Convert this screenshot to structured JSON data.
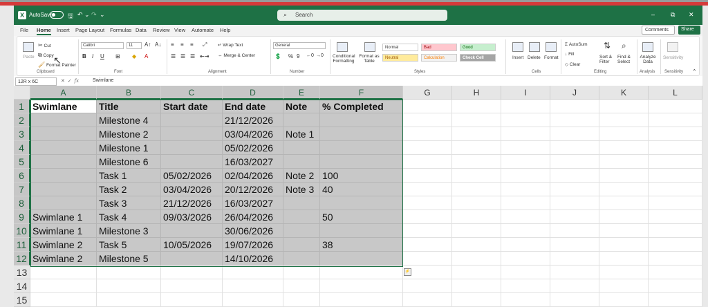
{
  "titlebar": {
    "app_icon": "X",
    "autosave_label": "AutoSave",
    "autosave_state": "Off",
    "search_placeholder": "Search",
    "minimize": "–",
    "restore": "⧉",
    "close": "✕"
  },
  "menu": {
    "tabs": [
      "File",
      "Home",
      "Insert",
      "Page Layout",
      "Formulas",
      "Data",
      "Review",
      "View",
      "Automate",
      "Help"
    ],
    "active_tab": "Home",
    "comments_label": "Comments",
    "share_label": "Share"
  },
  "ribbon": {
    "clipboard": {
      "paste": "Paste",
      "cut": "Cut",
      "copy": "Copy",
      "format_painter": "Format Painter",
      "label": "Clipboard"
    },
    "font": {
      "name": "Calibri",
      "size": "11",
      "label": "Font"
    },
    "alignment": {
      "wrap_text": "Wrap Text",
      "merge_center": "Merge & Center",
      "label": "Alignment"
    },
    "number": {
      "format": "General",
      "label": "Number"
    },
    "styles": {
      "conditional_formatting": "Conditional Formatting",
      "format_as_table": "Format as Table",
      "cells": [
        {
          "label": "Normal",
          "bg": "#ffffff",
          "fg": "#000000"
        },
        {
          "label": "Bad",
          "bg": "#ffc7ce",
          "fg": "#9c0006"
        },
        {
          "label": "Good",
          "bg": "#c6efce",
          "fg": "#006100"
        },
        {
          "label": "Neutral",
          "bg": "#ffeb9c",
          "fg": "#9c5700"
        },
        {
          "label": "Calculation",
          "bg": "#f2f2f2",
          "fg": "#fa7d00"
        },
        {
          "label": "Check Cell",
          "bg": "#a5a5a5",
          "fg": "#ffffff"
        }
      ],
      "label": "Styles"
    },
    "cells": {
      "insert": "Insert",
      "delete": "Delete",
      "format": "Format",
      "label": "Cells"
    },
    "editing": {
      "autosum": "AutoSum",
      "fill": "Fill",
      "clear": "Clear",
      "sort_filter": "Sort & Filter",
      "find_select": "Find & Select",
      "label": "Editing"
    },
    "analysis": {
      "analyze_data": "Analyze Data",
      "label": "Analysis"
    },
    "sensitivity": {
      "button": "Sensitivity",
      "label": "Sensitivity"
    }
  },
  "formula_bar": {
    "name_box": "12R x 6C",
    "cancel": "✕",
    "enter": "✓",
    "fx": "fx",
    "content": "Swimlane"
  },
  "sheet": {
    "columns": [
      "A",
      "B",
      "C",
      "D",
      "E",
      "F",
      "G",
      "H",
      "I",
      "J",
      "K",
      "L"
    ],
    "rows": [
      [
        "Swimlane",
        "Title",
        "Start date",
        "End date",
        "Note",
        "% Completed"
      ],
      [
        "",
        "Milestone 4",
        "",
        "21/12/2026",
        "",
        ""
      ],
      [
        "",
        "Milestone 2",
        "",
        "03/04/2026",
        "Note 1",
        ""
      ],
      [
        "",
        "Milestone 1",
        "",
        "05/02/2026",
        "",
        ""
      ],
      [
        "",
        "Milestone 6",
        "",
        "16/03/2027",
        "",
        ""
      ],
      [
        "",
        "Task 1",
        "05/02/2026",
        "02/04/2026",
        "Note 2",
        "100"
      ],
      [
        "",
        "Task 2",
        "03/04/2026",
        "20/12/2026",
        "Note 3",
        "40"
      ],
      [
        "",
        "Task 3",
        "21/12/2026",
        "16/03/2027",
        "",
        ""
      ],
      [
        "Swimlane 1",
        "Task 4",
        "09/03/2026",
        "26/04/2026",
        "",
        "50"
      ],
      [
        "Swimlane 1",
        "Milestone 3",
        "",
        "30/06/2026",
        "",
        ""
      ],
      [
        "Swimlane 2",
        "Task 5",
        "10/05/2026",
        "19/07/2026",
        "",
        "38"
      ],
      [
        "Swimlane 2",
        "Milestone 5",
        "",
        "14/10/2026",
        "",
        ""
      ],
      [
        "",
        "",
        "",
        "",
        "",
        ""
      ],
      [
        "",
        "",
        "",
        "",
        "",
        ""
      ],
      [
        "",
        "",
        "",
        "",
        "",
        ""
      ]
    ],
    "row_numbers": [
      "1",
      "2",
      "3",
      "4",
      "5",
      "6",
      "7",
      "8",
      "9",
      "10",
      "11",
      "12",
      "13",
      "14",
      "15"
    ],
    "selected_range_rows": 12,
    "selected_range_cols": 6
  }
}
